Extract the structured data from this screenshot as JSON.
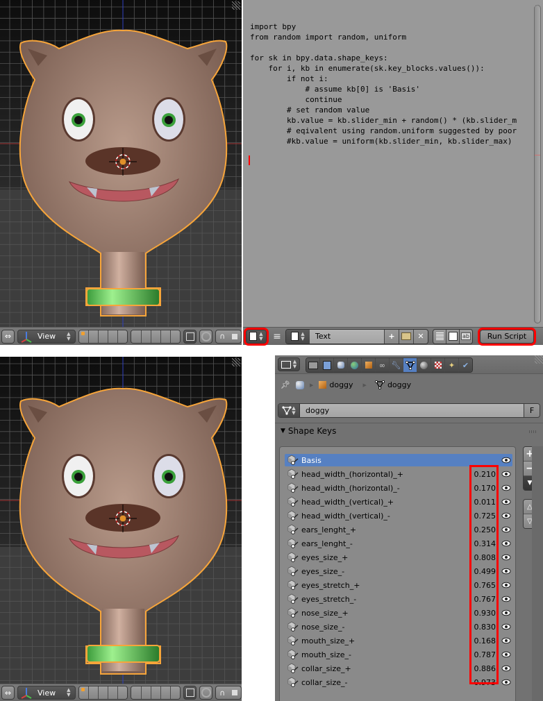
{
  "viewport_top": {
    "header": {
      "view_menu": "View",
      "icons": [
        "editor-type-3d-icon",
        "axis-gizmo-icon",
        "layers",
        "layers",
        "lock-camera-icon",
        "proportional-edit-icon",
        "snap-magnet-icon",
        "snap-element-icon"
      ]
    }
  },
  "text_editor": {
    "code_lines": [
      "import bpy",
      "from random import random, uniform",
      "",
      "for sk in bpy.data.shape_keys:",
      "    for i, kb in enumerate(sk.key_blocks.values()):",
      "        if not i:",
      "            # assume kb[0] is 'Basis'",
      "            continue",
      "        # set random value",
      "        kb.value = kb.slider_min + random() * (kb.slider_m",
      "        # eqivalent using random.uniform suggested by poor",
      "        #kb.value = uniform(kb.slider_min, kb.slider_max)"
    ],
    "header": {
      "editor_type": "text-editor-icon",
      "menu_icon": "hamburger-menu-icon",
      "datablock_name": "Text",
      "run_script_label": "Run Script"
    }
  },
  "viewport_bottom": {
    "header": {
      "view_menu": "View"
    }
  },
  "properties": {
    "context_tabs": [
      "render",
      "render-layers",
      "scene",
      "world",
      "object",
      "constraints",
      "modifiers",
      "data",
      "material",
      "texture",
      "particles",
      "physics"
    ],
    "active_tab": "data",
    "breadcrumb": {
      "object_name": "doggy",
      "mesh_name": "doggy"
    },
    "mesh_datablock": {
      "name": "doggy",
      "fake_user_label": "F"
    },
    "panel_title": "Shape Keys",
    "shape_keys": [
      {
        "name": "Basis",
        "value": null,
        "active": true
      },
      {
        "name": "head_width_(horizontal)_+",
        "value": "0.210"
      },
      {
        "name": "head_width_(horizontal)_-",
        "value": "0.170"
      },
      {
        "name": "head_width_(vertical)_+",
        "value": "0.011"
      },
      {
        "name": "head_width_(vertical)_-",
        "value": "0.725"
      },
      {
        "name": "ears_lenght_+",
        "value": "0.250"
      },
      {
        "name": "ears_lenght_-",
        "value": "0.314"
      },
      {
        "name": "eyes_size_+",
        "value": "0.808"
      },
      {
        "name": "eyes_size_-",
        "value": "0.499"
      },
      {
        "name": "eyes_stretch_+",
        "value": "0.765"
      },
      {
        "name": "eyes_stretch_-",
        "value": "0.767"
      },
      {
        "name": "nose_size_+",
        "value": "0.930"
      },
      {
        "name": "nose_size_-",
        "value": "0.830"
      },
      {
        "name": "mouth_size_+",
        "value": "0.168"
      },
      {
        "name": "mouth_size_-",
        "value": "0.787"
      },
      {
        "name": "collar_size_+",
        "value": "0.886"
      },
      {
        "name": "collar_size_-",
        "value": "0.973"
      }
    ],
    "side_buttons": {
      "add": "+",
      "remove": "−"
    }
  },
  "colors": {
    "selection_outline": "#f7a53a",
    "highlight_red": "#ff0000",
    "active_blue": "#5680c2",
    "text_editor_bg": "#999999",
    "properties_bg": "#727272"
  }
}
